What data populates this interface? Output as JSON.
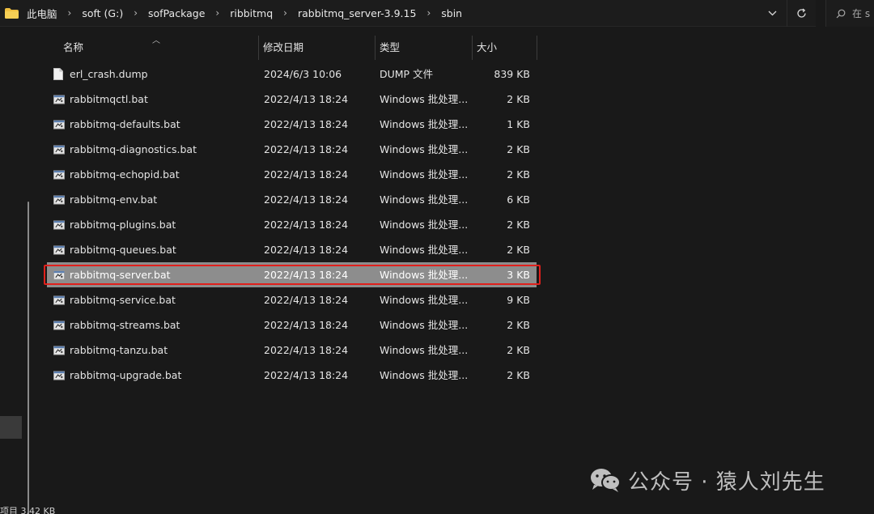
{
  "address_bar": {
    "breadcrumbs": [
      "此电脑",
      "soft (G:)",
      "sofPackage",
      "ribbitmq",
      "rabbitmq_server-3.9.15",
      "sbin"
    ],
    "separator": "›",
    "dropdown_icon": "chevron-down-icon",
    "refresh_icon": "refresh-icon"
  },
  "search": {
    "placeholder": "在 s"
  },
  "columns": {
    "name": "名称",
    "date": "修改日期",
    "type": "类型",
    "size": "大小"
  },
  "files": [
    {
      "name": "erl_crash.dump",
      "date": "2024/6/3 10:06",
      "type": "DUMP 文件",
      "size": "839 KB",
      "icon": "file-icon",
      "selected": false
    },
    {
      "name": "rabbitmqctl.bat",
      "date": "2022/4/13 18:24",
      "type": "Windows 批处理...",
      "size": "2 KB",
      "icon": "batch-file-icon",
      "selected": false
    },
    {
      "name": "rabbitmq-defaults.bat",
      "date": "2022/4/13 18:24",
      "type": "Windows 批处理...",
      "size": "1 KB",
      "icon": "batch-file-icon",
      "selected": false
    },
    {
      "name": "rabbitmq-diagnostics.bat",
      "date": "2022/4/13 18:24",
      "type": "Windows 批处理...",
      "size": "2 KB",
      "icon": "batch-file-icon",
      "selected": false
    },
    {
      "name": "rabbitmq-echopid.bat",
      "date": "2022/4/13 18:24",
      "type": "Windows 批处理...",
      "size": "2 KB",
      "icon": "batch-file-icon",
      "selected": false
    },
    {
      "name": "rabbitmq-env.bat",
      "date": "2022/4/13 18:24",
      "type": "Windows 批处理...",
      "size": "6 KB",
      "icon": "batch-file-icon",
      "selected": false
    },
    {
      "name": "rabbitmq-plugins.bat",
      "date": "2022/4/13 18:24",
      "type": "Windows 批处理...",
      "size": "2 KB",
      "icon": "batch-file-icon",
      "selected": false
    },
    {
      "name": "rabbitmq-queues.bat",
      "date": "2022/4/13 18:24",
      "type": "Windows 批处理...",
      "size": "2 KB",
      "icon": "batch-file-icon",
      "selected": false
    },
    {
      "name": "rabbitmq-server.bat",
      "date": "2022/4/13 18:24",
      "type": "Windows 批处理...",
      "size": "3 KB",
      "icon": "batch-file-icon",
      "selected": true
    },
    {
      "name": "rabbitmq-service.bat",
      "date": "2022/4/13 18:24",
      "type": "Windows 批处理...",
      "size": "9 KB",
      "icon": "batch-file-icon",
      "selected": false
    },
    {
      "name": "rabbitmq-streams.bat",
      "date": "2022/4/13 18:24",
      "type": "Windows 批处理...",
      "size": "2 KB",
      "icon": "batch-file-icon",
      "selected": false
    },
    {
      "name": "rabbitmq-tanzu.bat",
      "date": "2022/4/13 18:24",
      "type": "Windows 批处理...",
      "size": "2 KB",
      "icon": "batch-file-icon",
      "selected": false
    },
    {
      "name": "rabbitmq-upgrade.bat",
      "date": "2022/4/13 18:24",
      "type": "Windows 批处理...",
      "size": "2 KB",
      "icon": "batch-file-icon",
      "selected": false
    }
  ],
  "status_bar": {
    "text": "项目 3.42 KB"
  },
  "watermark": {
    "text": "公众号 · 猿人刘先生",
    "icon": "wechat-icon"
  },
  "colors": {
    "background": "#191919",
    "selected_row": "#8d8d8d",
    "highlight_border": "#e0201c",
    "folder": "#f0c040"
  }
}
